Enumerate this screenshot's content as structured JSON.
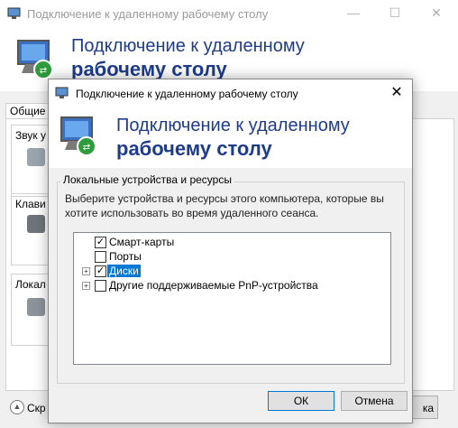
{
  "background_window": {
    "title": "Подключение к удаленному рабочему столу",
    "header_line1": "Подключение к удаленному",
    "header_line2": "рабочему столу",
    "tab_general": "Общие",
    "group_sound": "Звук у",
    "group_keyboard": "Клави",
    "group_local": "Локал",
    "bottom_label": "Скр",
    "right_button_fragment": "ка",
    "controls": {
      "minimize": "—",
      "maximize": "☐",
      "close": "✕"
    }
  },
  "dialog": {
    "title": "Подключение к удаленному рабочему столу",
    "close_glyph": "✕",
    "header_line1": "Подключение к удаленному",
    "header_line2": "рабочему столу",
    "group_label": "Локальные устройства и ресурсы",
    "description": "Выберите устройства и ресурсы этого компьютера, которые вы хотите использовать во время удаленного сеанса.",
    "tree": [
      {
        "label": "Смарт-карты",
        "checked": true,
        "expander": "",
        "check_glyph": "✓"
      },
      {
        "label": "Порты",
        "checked": false,
        "expander": "",
        "check_glyph": ""
      },
      {
        "label": "Диски",
        "checked": true,
        "expander": "+",
        "check_glyph": "✓",
        "selected": true
      },
      {
        "label": "Другие поддерживаемые PnP-устройства",
        "checked": false,
        "expander": "+",
        "check_glyph": ""
      }
    ],
    "ok_label": "ОК",
    "cancel_label": "Отмена"
  },
  "colors": {
    "heading": "#1e3c8c",
    "selection": "#0078d7"
  },
  "icons": {
    "app": "remote-desktop-icon"
  }
}
